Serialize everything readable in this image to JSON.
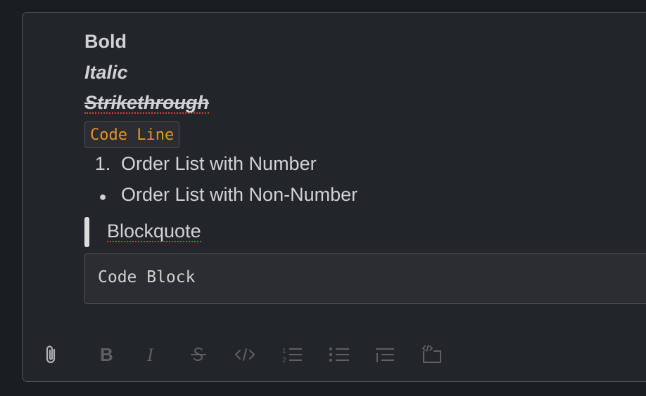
{
  "editor": {
    "bold_text": "Bold",
    "italic_text": "Italic",
    "strike_text": "Strikethrough",
    "code_line_text": "Code Line",
    "ordered_item": {
      "marker": "1.",
      "text": "Order List with Number"
    },
    "bullet_item": {
      "marker": "●",
      "text": "Order List with Non-Number"
    },
    "blockquote_text": "Blockquote",
    "code_block_text": "Code Block"
  },
  "toolbar": {
    "items": [
      "attach-icon",
      "bold-icon",
      "italic-icon",
      "strikethrough-icon",
      "code-icon",
      "ordered-list-icon",
      "bullet-list-icon",
      "blockquote-icon",
      "code-block-icon"
    ]
  },
  "colors": {
    "background": "#1a1d21",
    "composer": "#222529",
    "text": "#d1d2d3",
    "code_inline": "#e8912d",
    "icon": "#5e6064"
  }
}
